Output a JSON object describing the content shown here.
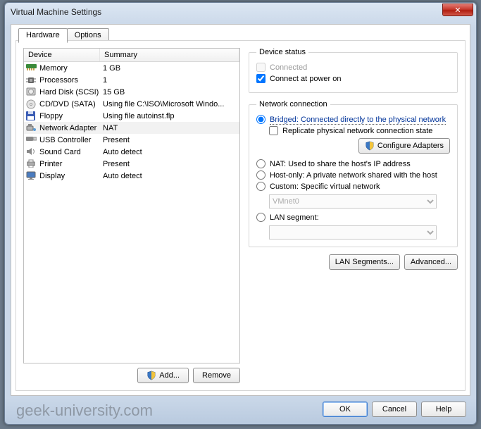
{
  "window": {
    "title": "Virtual Machine Settings",
    "close_icon": "✕"
  },
  "tabs": {
    "hardware": "Hardware",
    "options": "Options"
  },
  "columns": {
    "device": "Device",
    "summary": "Summary"
  },
  "devices": [
    {
      "name": "Memory",
      "summary": "1 GB",
      "icon": "memory"
    },
    {
      "name": "Processors",
      "summary": "1",
      "icon": "cpu"
    },
    {
      "name": "Hard Disk (SCSI)",
      "summary": "15 GB",
      "icon": "hdd"
    },
    {
      "name": "CD/DVD (SATA)",
      "summary": "Using file C:\\ISO\\Microsoft Windo...",
      "icon": "cd"
    },
    {
      "name": "Floppy",
      "summary": "Using file autoinst.flp",
      "icon": "floppy"
    },
    {
      "name": "Network Adapter",
      "summary": "NAT",
      "icon": "net",
      "selected": true
    },
    {
      "name": "USB Controller",
      "summary": "Present",
      "icon": "usb"
    },
    {
      "name": "Sound Card",
      "summary": "Auto detect",
      "icon": "sound"
    },
    {
      "name": "Printer",
      "summary": "Present",
      "icon": "printer"
    },
    {
      "name": "Display",
      "summary": "Auto detect",
      "icon": "display"
    }
  ],
  "left_buttons": {
    "add": "Add...",
    "remove": "Remove"
  },
  "device_status": {
    "title": "Device status",
    "connected": "Connected",
    "connect_power_on": "Connect at power on"
  },
  "network": {
    "title": "Network connection",
    "bridged": "Bridged: Connected directly to the physical network",
    "replicate": "Replicate physical network connection state",
    "configure": "Configure Adapters",
    "nat": "NAT: Used to share the host's IP address",
    "host_only": "Host-only: A private network shared with the host",
    "custom": "Custom: Specific virtual network",
    "custom_value": "VMnet0",
    "lan_segment": "LAN segment:",
    "lan_segments_btn": "LAN Segments...",
    "advanced_btn": "Advanced..."
  },
  "bottom": {
    "ok": "OK",
    "cancel": "Cancel",
    "help": "Help"
  },
  "watermark": "geek-university.com"
}
